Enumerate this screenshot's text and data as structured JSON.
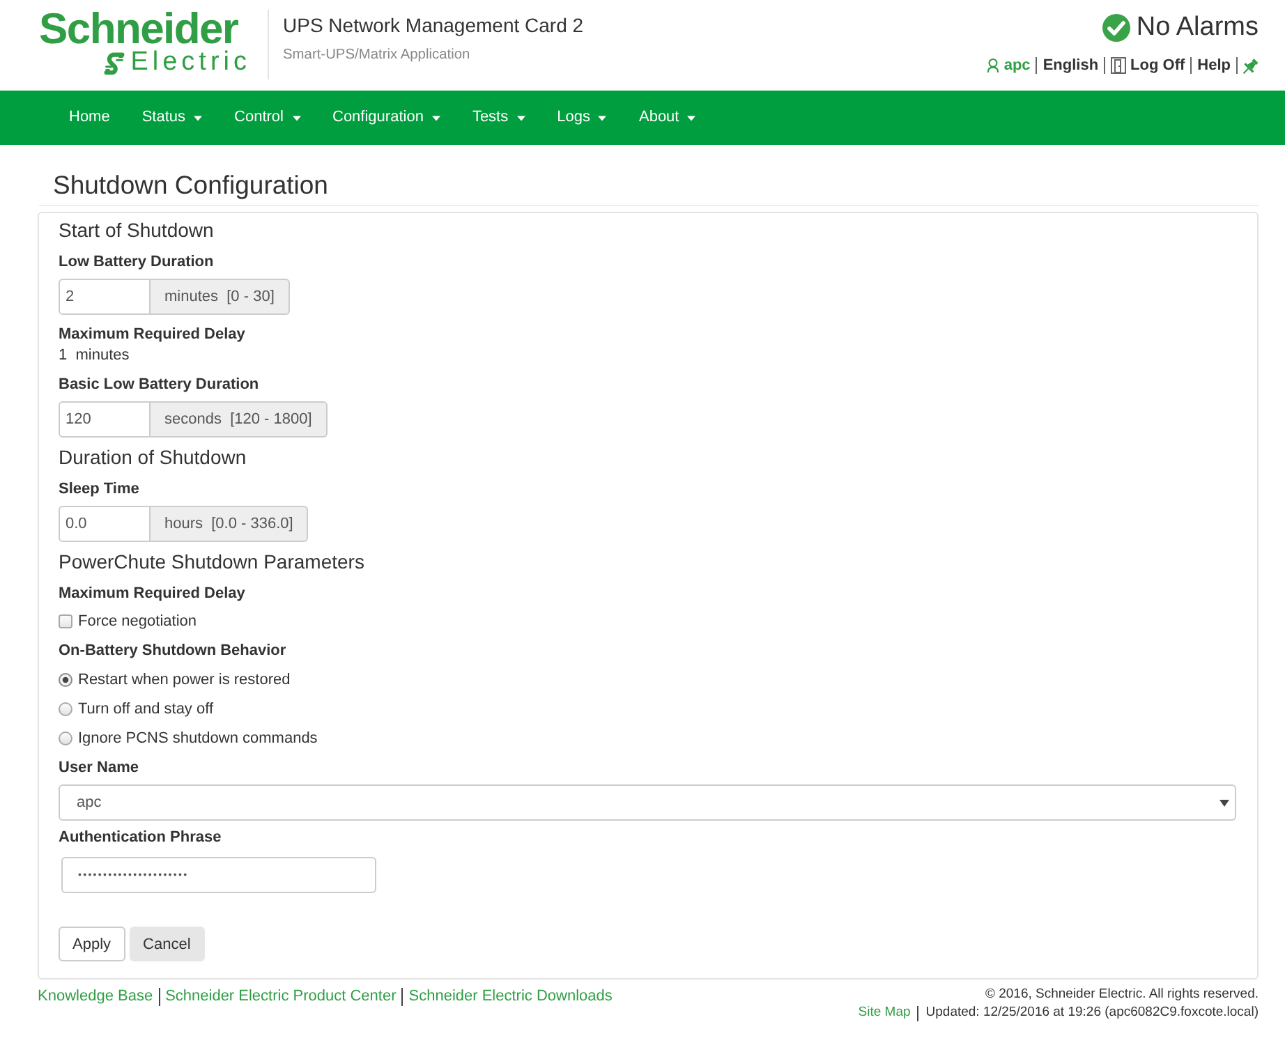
{
  "header": {
    "logo": {
      "line_1": "Schneider",
      "line_2": "Electric"
    },
    "title": "UPS Network Management Card 2",
    "subtitle": "Smart-UPS/Matrix Application",
    "alarm_status": "No Alarms",
    "user_links": [
      {
        "kind": "user",
        "label": "apc"
      },
      {
        "kind": "language",
        "label": "English"
      },
      {
        "kind": "logoff",
        "label": "Log Off"
      },
      {
        "kind": "help",
        "label": "Help"
      }
    ]
  },
  "nav": {
    "items": [
      {
        "label": "Home",
        "dropdown": false
      },
      {
        "label": "Status",
        "dropdown": true
      },
      {
        "label": "Control",
        "dropdown": true
      },
      {
        "label": "Configuration",
        "dropdown": true
      },
      {
        "label": "Tests",
        "dropdown": true
      },
      {
        "label": "Logs",
        "dropdown": true
      },
      {
        "label": "About",
        "dropdown": true
      }
    ]
  },
  "page_title": "Shutdown Configuration",
  "sections": [
    {
      "heading": "Start of Shutdown",
      "fields": [
        {
          "kind": "number",
          "label": "Low Battery Duration",
          "value": "2",
          "unit": "minutes  [0 - 30]"
        },
        {
          "kind": "readout",
          "label": "Maximum Required Delay",
          "value": "1  minutes"
        },
        {
          "kind": "number",
          "label": "Basic Low Battery Duration",
          "value": "120",
          "unit": "seconds  [120 - 1800]"
        }
      ]
    },
    {
      "heading": "Duration of Shutdown",
      "fields": [
        {
          "kind": "number",
          "label": "Sleep Time",
          "value": "0.0",
          "unit": "hours  [0.0 - 336.0]"
        }
      ]
    },
    {
      "heading": "PowerChute Shutdown Parameters",
      "fields": [
        {
          "kind": "checkbox",
          "label": "Maximum Required Delay",
          "options": [
            {
              "label": "Force negotiation",
              "checked": false
            }
          ]
        },
        {
          "kind": "radio",
          "label": "On-Battery Shutdown Behavior",
          "options": [
            {
              "label": "Restart when power is restored",
              "selected": true
            },
            {
              "label": "Turn off and stay off",
              "selected": false
            },
            {
              "label": "Ignore PCNS shutdown commands",
              "selected": false
            }
          ]
        },
        {
          "kind": "select",
          "label": "User Name",
          "value": "apc"
        },
        {
          "kind": "password",
          "label": "Authentication Phrase",
          "value": "••••••••••••••••••••••"
        }
      ]
    }
  ],
  "buttons": [
    {
      "kind": "submit",
      "label": "Apply"
    },
    {
      "kind": "cancel",
      "label": "Cancel"
    }
  ],
  "footer": {
    "links": [
      "Knowledge Base",
      "Schneider Electric Product Center",
      "Schneider Electric Downloads"
    ],
    "copyright": "© 2016, Schneider Electric. All rights reserved.",
    "site_map": "Site Map",
    "updated": "Updated: 12/25/2016 at 19:26 (apc6082C9.foxcote.local)"
  }
}
